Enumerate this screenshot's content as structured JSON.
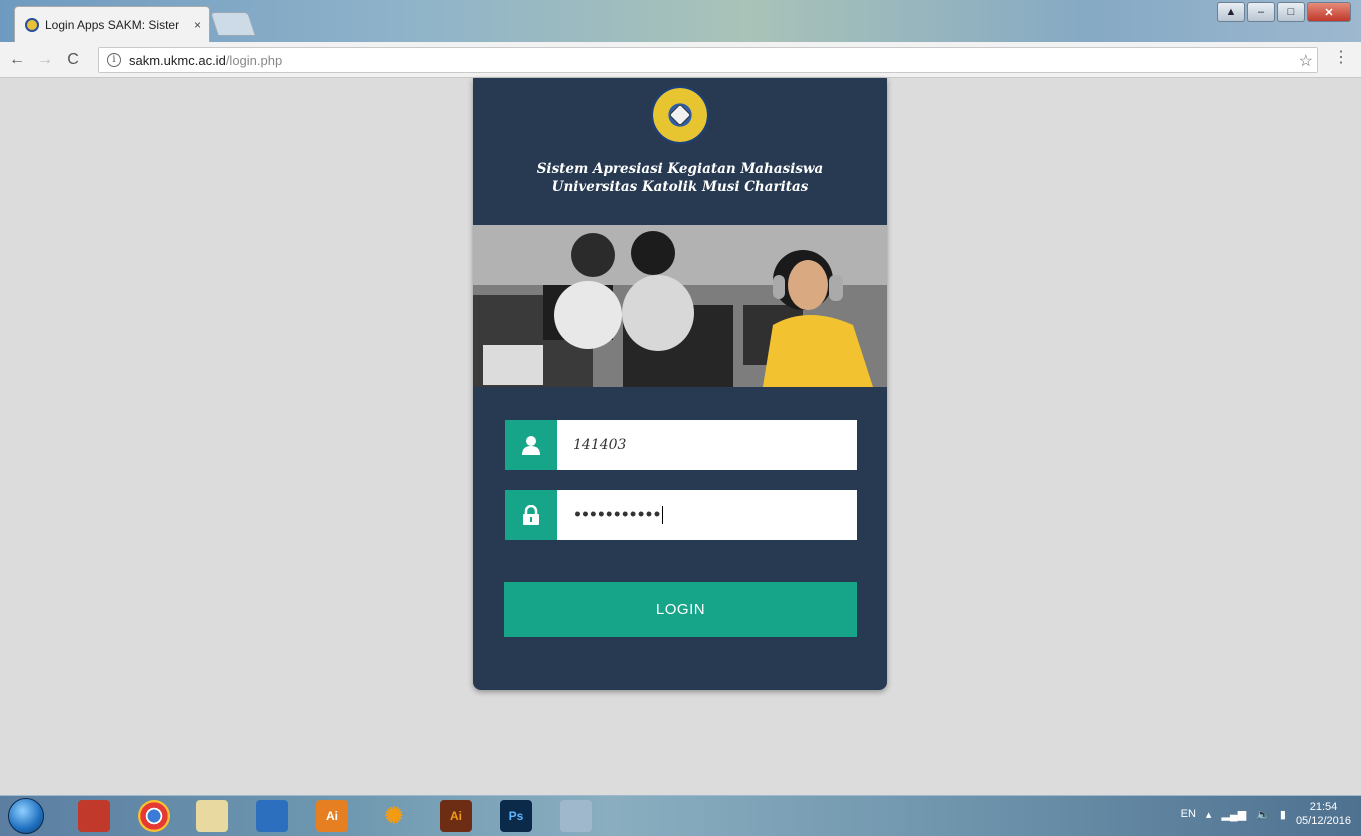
{
  "browser": {
    "tab_title": "Login Apps SAKM: Sister",
    "tab_close": "×",
    "url_host": "sakm.ukmc.ac.id",
    "url_path": "/login.php",
    "star": "☆",
    "menu": "⋮"
  },
  "card": {
    "title_line1": "Sistem Apresiasi Kegiatan Mahasiswa",
    "title_line2": "Universitas Katolik Musi Charitas"
  },
  "form": {
    "username_value": "141403",
    "password_value": "•••••••••••",
    "login_label": "LOGIN"
  },
  "taskbar": {
    "lang": "EN",
    "time": "21:54",
    "date": "05/12/2016",
    "apps": [
      "Ai",
      "Ps",
      "Ai"
    ]
  },
  "colors": {
    "card_bg": "#273a51",
    "accent": "#17a589",
    "page_bg": "#dcdcdc"
  }
}
